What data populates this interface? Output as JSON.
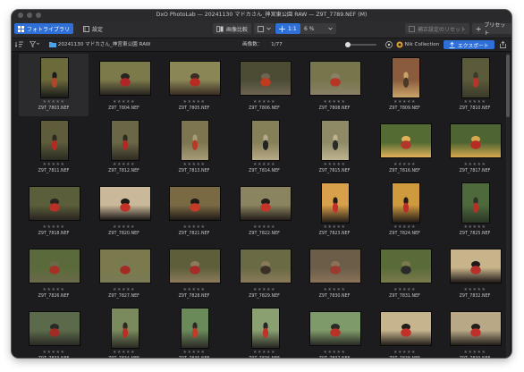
{
  "window": {
    "title": "DxO PhotoLab — 20241130 マドカさん_神宮東公園 RAW — Z9T_7789.NEF (M)"
  },
  "toolbar": {
    "tab_library": "フォトライブラリ",
    "tab_customize": "設定",
    "compare_label": "画像比較",
    "zoom_label": "1:1",
    "zoom_percent": "6 %",
    "reset_label": "補正設定のリセット",
    "preset_label": "プリセット"
  },
  "subbar": {
    "folder": "20241130 マドカさん_神宮東公園 RAW",
    "count_label": "画像数：",
    "count_value": "1/77",
    "nik_label": "Nik Collection",
    "export_label": "エクスポート"
  },
  "rating_glyph": "★★★★★",
  "photos": [
    {
      "name": "Z9T_7803.NEF",
      "o": "p",
      "c": [
        "#6b6a3a",
        "#b2462c",
        "#1a1a1a"
      ]
    },
    {
      "name": "Z9T_7804.NEF",
      "o": "l",
      "c": [
        "#7a7a4a",
        "#b02525",
        "#2a2420"
      ]
    },
    {
      "name": "Z9T_7805.NEF",
      "o": "l",
      "c": [
        "#8a8656",
        "#b82a22",
        "#3a2c22"
      ]
    },
    {
      "name": "Z9T_7806.NEF",
      "o": "l",
      "c": [
        "#4c4c34",
        "#c23a1e",
        "#6e6452"
      ]
    },
    {
      "name": "Z9T_7808.NEF",
      "o": "l",
      "c": [
        "#77754c",
        "#b63524",
        "#8a8068"
      ]
    },
    {
      "name": "Z9T_7809.NEF",
      "o": "p",
      "c": [
        "#8a5b3c",
        "#4a3a2a",
        "#c9a56a"
      ]
    },
    {
      "name": "Z9T_7810.NEF",
      "o": "p",
      "c": [
        "#5b5a3a",
        "#b8342a",
        "#3a3a2a"
      ]
    },
    {
      "name": "Z9T_7811.NEF",
      "o": "p",
      "c": [
        "#5e5c3a",
        "#b52b22",
        "#2a2a22"
      ]
    },
    {
      "name": "Z9T_7812.NEF",
      "o": "p",
      "c": [
        "#6a6746",
        "#b02a24",
        "#2e2a22"
      ]
    },
    {
      "name": "Z9T_7813.NEF",
      "o": "p",
      "c": [
        "#7c7550",
        "#b83a26",
        "#a89c78"
      ]
    },
    {
      "name": "Z9T_7814.NEF",
      "o": "p",
      "c": [
        "#868058",
        "#222222",
        "#b8aa88"
      ]
    },
    {
      "name": "Z9T_7815.NEF",
      "o": "p",
      "c": [
        "#8e8a66",
        "#2a2a2a",
        "#c0b490"
      ]
    },
    {
      "name": "Z9T_7816.NEF",
      "o": "l",
      "c": [
        "#556b34",
        "#b2362a",
        "#e0b05a"
      ]
    },
    {
      "name": "Z9T_7817.NEF",
      "o": "l",
      "c": [
        "#4e6432",
        "#b82a24",
        "#d6a84e"
      ]
    },
    {
      "name": "Z9T_7818.NEF",
      "o": "l",
      "c": [
        "#5a5e3a",
        "#b93024",
        "#2a2420"
      ]
    },
    {
      "name": "Z9T_7820.NEF",
      "o": "l",
      "c": [
        "#c9b89a",
        "#c03226",
        "#1e1a18"
      ]
    },
    {
      "name": "Z9T_7821.NEF",
      "o": "l",
      "c": [
        "#7a6a44",
        "#c33a26",
        "#1e1a16"
      ]
    },
    {
      "name": "Z9T_7822.NEF",
      "o": "l",
      "c": [
        "#8a8460",
        "#c23528",
        "#241e1a"
      ]
    },
    {
      "name": "Z9T_7823.NEF",
      "o": "p",
      "c": [
        "#d8a04a",
        "#c2302a",
        "#221c18"
      ]
    },
    {
      "name": "Z9T_7824.NEF",
      "o": "p",
      "c": [
        "#cf9a3e",
        "#be2e26",
        "#201a16"
      ]
    },
    {
      "name": "Z9T_7825.NEF",
      "o": "p",
      "c": [
        "#4e6a3c",
        "#b73024",
        "#2a3426"
      ]
    },
    {
      "name": "Z9T_7826.NEF",
      "o": "l",
      "c": [
        "#5a6a3a",
        "#a43026",
        "#6a6a4a"
      ]
    },
    {
      "name": "Z9T_7827.NEF",
      "o": "l",
      "c": [
        "#7b7a4c",
        "#a22c24",
        "#7a7a56"
      ]
    },
    {
      "name": "Z9T_7828.NEF",
      "o": "l",
      "c": [
        "#5e5e3a",
        "#a42c26",
        "#8c7a5c"
      ]
    },
    {
      "name": "Z9T_7829.NEF",
      "o": "l",
      "c": [
        "#6a6a44",
        "#3a3028",
        "#8a7a5a"
      ]
    },
    {
      "name": "Z9T_7830.NEF",
      "o": "l",
      "c": [
        "#6b5d48",
        "#9a3a2e",
        "#8a7258"
      ]
    },
    {
      "name": "Z9T_7831.NEF",
      "o": "l",
      "c": [
        "#5a6b3a",
        "#2a2a2a",
        "#7a7a4a"
      ]
    },
    {
      "name": "Z9T_7832.NEF",
      "o": "l",
      "c": [
        "#c8b48a",
        "#b8302a",
        "#1e1a18"
      ]
    },
    {
      "name": "Z9T_7833.NEF",
      "o": "l",
      "c": [
        "#5a6a4a",
        "#a02c26",
        "#2a2a26"
      ]
    },
    {
      "name": "Z9T_7834.NEF",
      "o": "p",
      "c": [
        "#7a8a5c",
        "#b83026",
        "#2a2a24"
      ]
    },
    {
      "name": "Z9T_7835.NEF",
      "o": "p",
      "c": [
        "#6a8a5a",
        "#c23a28",
        "#2c2a26"
      ]
    },
    {
      "name": "Z9T_7836.NEF",
      "o": "p",
      "c": [
        "#8aa070",
        "#c2302a",
        "#262622"
      ]
    },
    {
      "name": "Z9T_7837.NEF",
      "o": "l",
      "c": [
        "#7e9a6a",
        "#b83226",
        "#2a2a26"
      ]
    },
    {
      "name": "Z9T_7838.NEF",
      "o": "l",
      "c": [
        "#c6b48c",
        "#c2302a",
        "#221e1a"
      ]
    },
    {
      "name": "Z9T_7839.NEF",
      "o": "l",
      "c": [
        "#b8a886",
        "#c0302a",
        "#221e1a"
      ]
    }
  ]
}
